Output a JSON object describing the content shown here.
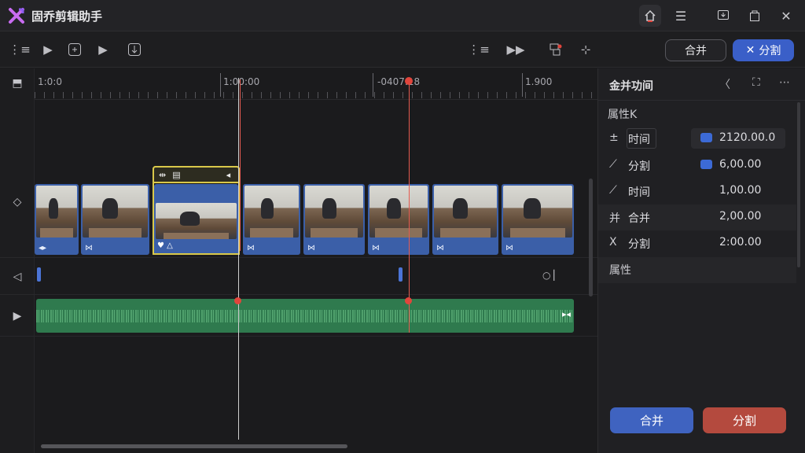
{
  "app": {
    "title": "固乔剪辑助手",
    "accent": "#3a5fc8",
    "danger": "#b44a3e"
  },
  "titlebar_icons": [
    "home-icon",
    "list-icon",
    "download-icon",
    "copy-icon",
    "close-icon"
  ],
  "toolbar": {
    "merge_label": "合并",
    "split_label": "分割",
    "icons": [
      "list-icon",
      "play-icon",
      "frame-icon",
      "play-icon",
      "export-icon",
      "list-icon",
      "fast-forward-icon",
      "record-icon",
      "settings-icon"
    ]
  },
  "ruler": {
    "labels": [
      "1:0:0",
      "1:00:00",
      "-0407:18",
      "1.900"
    ]
  },
  "panel": {
    "title": "金并功间",
    "section1": "属性K",
    "rows": [
      {
        "icon": "±",
        "label": "时间",
        "value": "2120.00.0"
      },
      {
        "icon": "⟋",
        "label": "分割",
        "value": "6,00.00"
      },
      {
        "icon": "⟋",
        "label": "时间",
        "value": "1,00.00"
      },
      {
        "icon": "并",
        "label": "合并",
        "value": "2,00.00"
      },
      {
        "icon": "X",
        "label": "分割",
        "value": "2:00.00"
      }
    ],
    "section2": "属性",
    "merge_button": "合并",
    "split_button": "分割"
  }
}
